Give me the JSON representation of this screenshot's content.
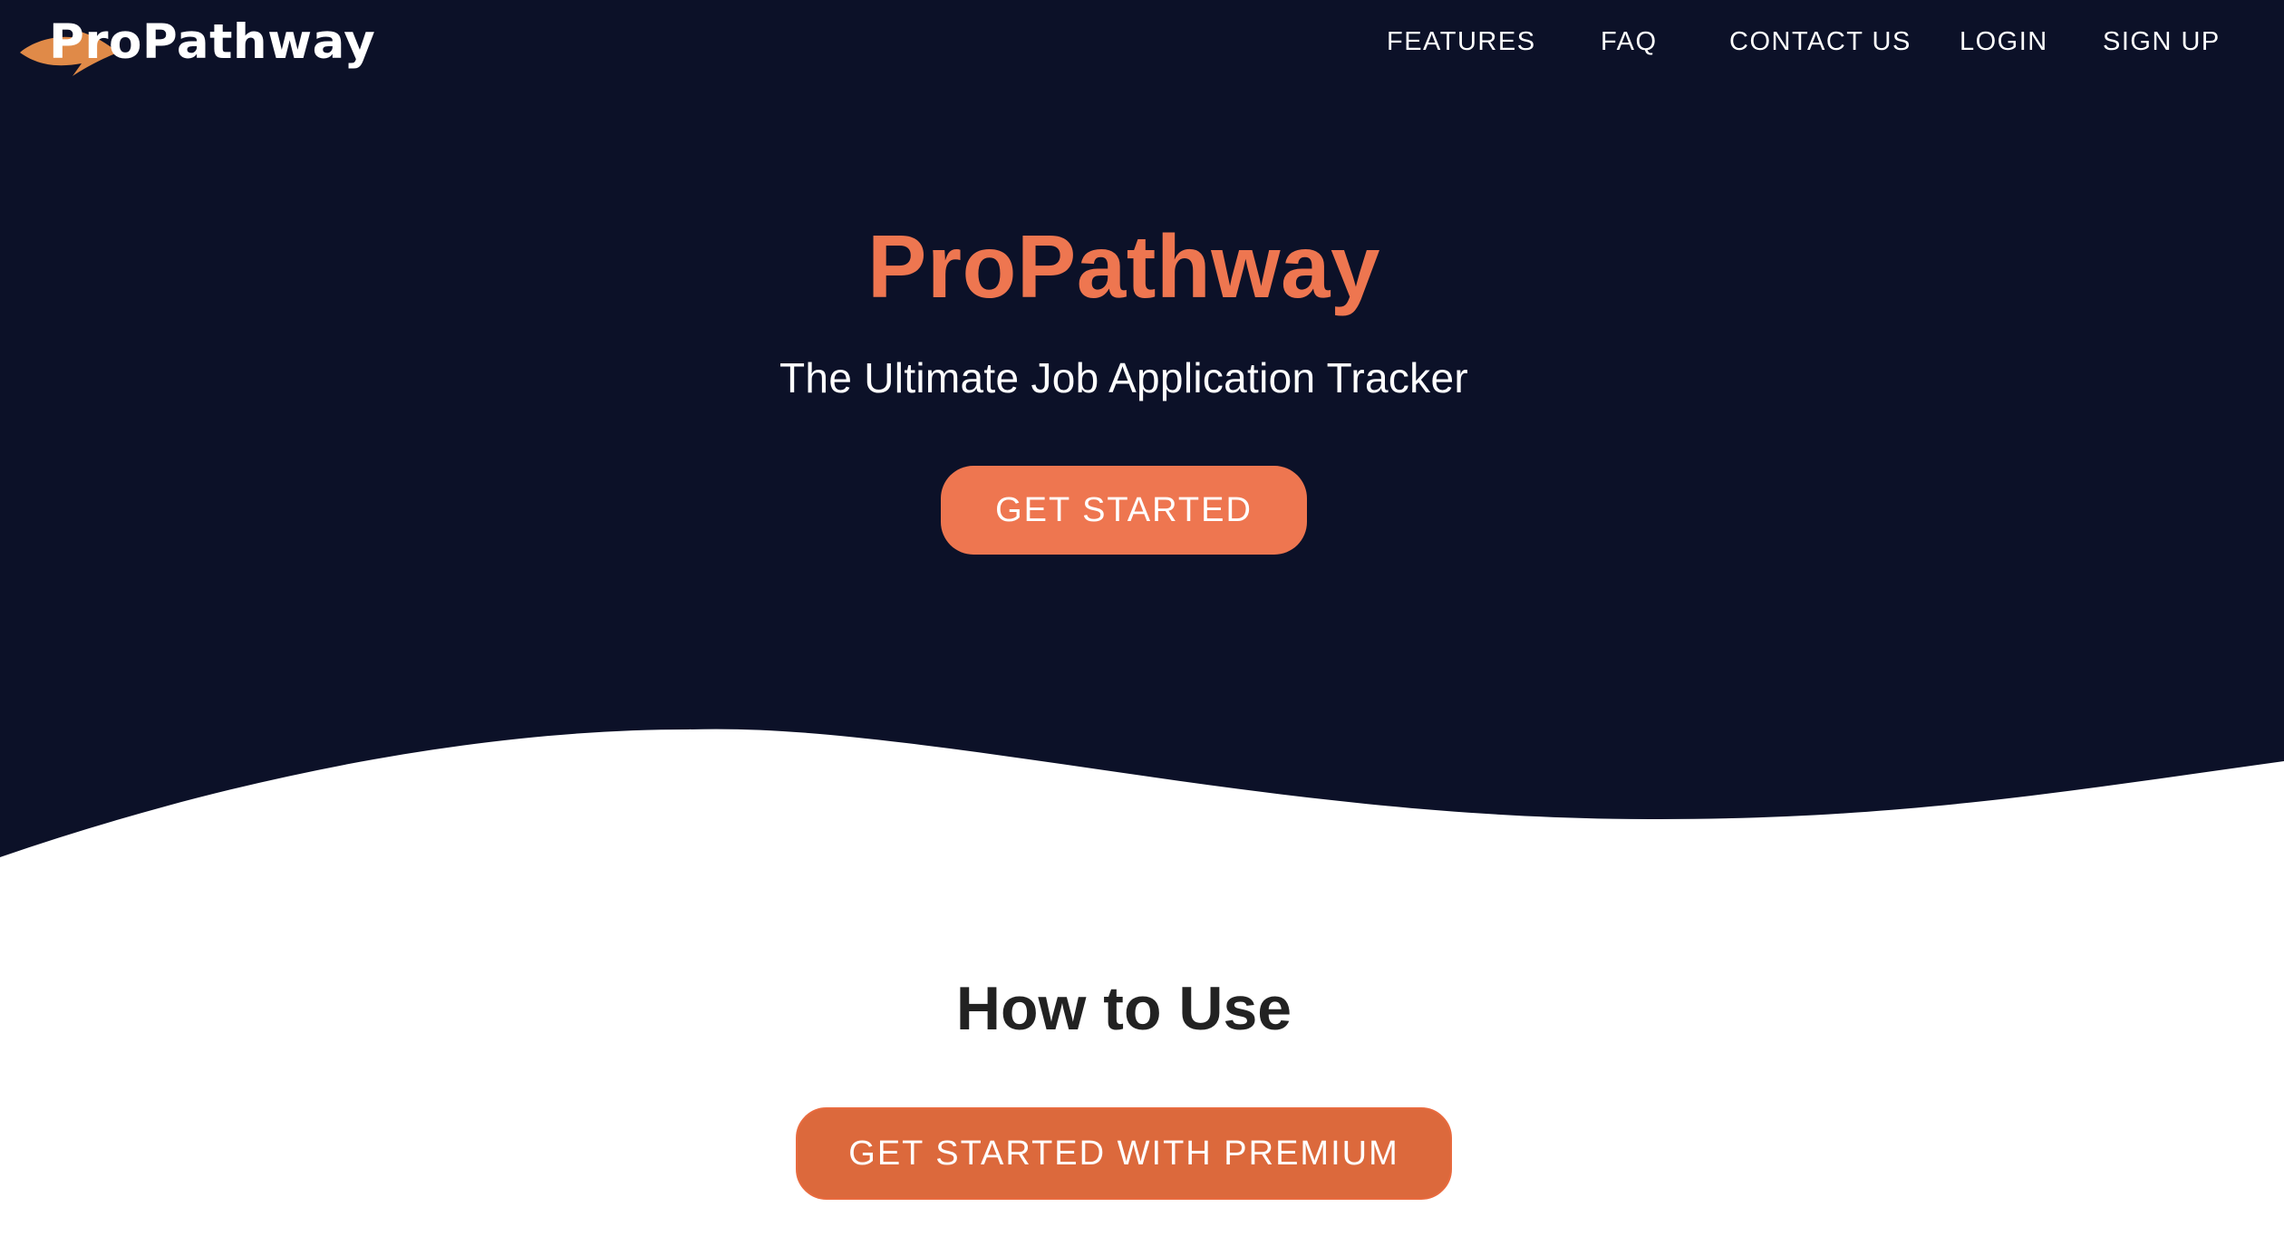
{
  "brand": {
    "logo_text": "ProPathway",
    "logo_accent_color": "#e08a48"
  },
  "nav": {
    "items": [
      {
        "label": "FEATURES"
      },
      {
        "label": "FAQ"
      },
      {
        "label": "CONTACT US"
      },
      {
        "label": "LOGIN"
      },
      {
        "label": "SIGN UP"
      }
    ]
  },
  "hero": {
    "title": "ProPathway",
    "subtitle": "The Ultimate Job Application Tracker",
    "cta_label": "GET STARTED",
    "background_color": "#0c1128",
    "accent_color": "#ee7650"
  },
  "how_to_use": {
    "title": "How to Use",
    "cta_label": "GET STARTED WITH PREMIUM",
    "button_color": "#dc693c"
  }
}
